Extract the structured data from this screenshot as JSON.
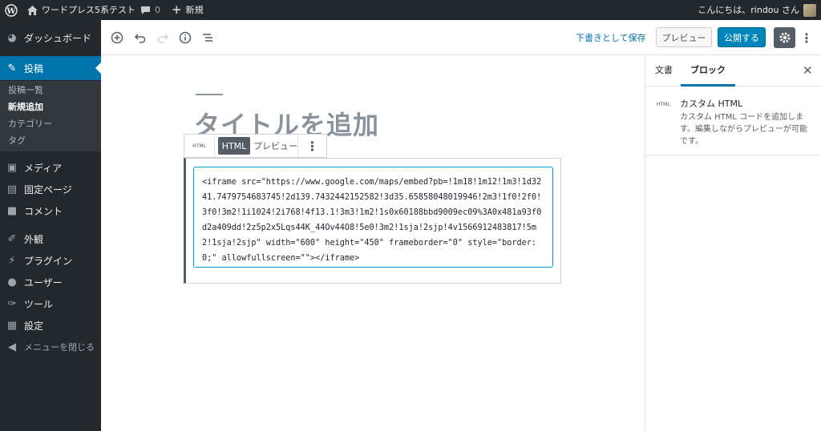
{
  "adminbar": {
    "site_name": "ワードプレス5系テスト",
    "comment_count": "0",
    "new_label": "新規",
    "greeting": "こんにちは、rindou さん"
  },
  "sidebar": {
    "dashboard": "ダッシュボード",
    "posts": "投稿",
    "sub": [
      "投稿一覧",
      "新規追加",
      "カテゴリー",
      "タグ"
    ],
    "media": "メディア",
    "pages": "固定ページ",
    "comments": "コメント",
    "appearance": "外観",
    "plugins": "プラグイン",
    "users": "ユーザー",
    "tools": "ツール",
    "settings": "設定",
    "collapse": "メニューを閉じる"
  },
  "header": {
    "save_draft": "下書きとして保存",
    "preview": "プレビュー",
    "publish": "公開する"
  },
  "editor": {
    "title_placeholder": "タイトルを追加",
    "block_type_label": "HTML",
    "html_tab": "HTML",
    "preview_tab": "プレビュー",
    "html_code": "<iframe src=\"https://www.google.com/maps/embed?pb=!1m18!1m12!1m3!1d3241.7479754683745!2d139.7432442152582!3d35.65858048019946!2m3!1f0!2f0!3f0!3m2!1i1024!2i768!4f13.1!3m3!1m2!1s0x60188bbd9009ec09%3A0x481a93f0d2a409dd!2z5p2x5Lqs44K_44Ov44O8!5e0!3m2!1sja!2sjp!4v1566912483817!5m2!1sja!2sjp\" width=\"600\" height=\"450\" frameborder=\"0\" style=\"border:0;\" allowfullscreen=\"\"></iframe>"
  },
  "panel": {
    "tab_document": "文書",
    "tab_block": "ブロック",
    "block_icon": "HTML",
    "block_title": "カスタム HTML",
    "block_desc": "カスタム HTML コードを追加します。編集しながらプレビューが可能です。"
  },
  "colors": {
    "admin_dark": "#23282d",
    "accent": "#0073aa",
    "publish": "#0085ba"
  }
}
